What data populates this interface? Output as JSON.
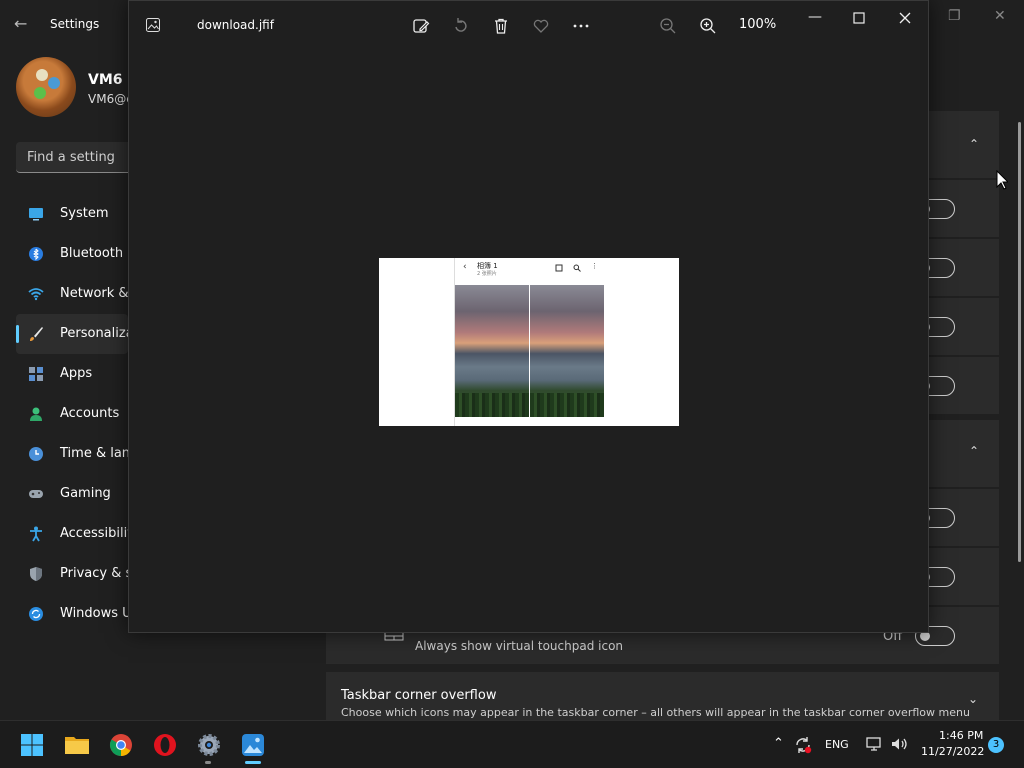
{
  "settings": {
    "title": "Settings",
    "profile": {
      "name": "VM6",
      "email": "VM6@c"
    },
    "search_placeholder": "Find a setting",
    "nav": [
      {
        "label": "System",
        "icon": "monitor-icon"
      },
      {
        "label": "Bluetooth &",
        "icon": "bluetooth-icon"
      },
      {
        "label": "Network &",
        "icon": "wifi-icon"
      },
      {
        "label": "Personaliza",
        "icon": "brush-icon"
      },
      {
        "label": "Apps",
        "icon": "apps-icon"
      },
      {
        "label": "Accounts",
        "icon": "person-icon"
      },
      {
        "label": "Time & lan",
        "icon": "clock-globe-icon"
      },
      {
        "label": "Gaming",
        "icon": "gamepad-icon"
      },
      {
        "label": "Accessibilit",
        "icon": "accessibility-icon"
      },
      {
        "label": "Privacy & s",
        "icon": "shield-icon"
      },
      {
        "label": "Windows U",
        "icon": "update-icon"
      }
    ],
    "touchpad": {
      "subtitle": "Always show virtual touchpad icon",
      "state": "Off"
    },
    "overflow": {
      "title": "Taskbar corner overflow",
      "subtitle": "Choose which icons may appear in the taskbar corner – all others will appear in the taskbar corner overflow menu"
    }
  },
  "photos": {
    "filename": "download.jfif",
    "zoom": "100%",
    "toolbar_icons": [
      "edit-image-icon",
      "rotate-icon",
      "delete-icon",
      "favorite-heart-icon",
      "more-icon",
      "zoom-out-icon",
      "zoom-in-icon"
    ],
    "image": {
      "title": "相簿 1",
      "subtitle": "2 张照片"
    }
  },
  "taskbar": {
    "apps": [
      "start-icon",
      "file-explorer-icon",
      "chrome-icon",
      "opera-icon",
      "settings-icon",
      "photos-icon"
    ],
    "language": "ENG",
    "time": "1:46 PM",
    "date": "11/27/2022",
    "notification_count": "3"
  },
  "colors": {
    "accent": "#60cdff",
    "background": "#202020"
  }
}
